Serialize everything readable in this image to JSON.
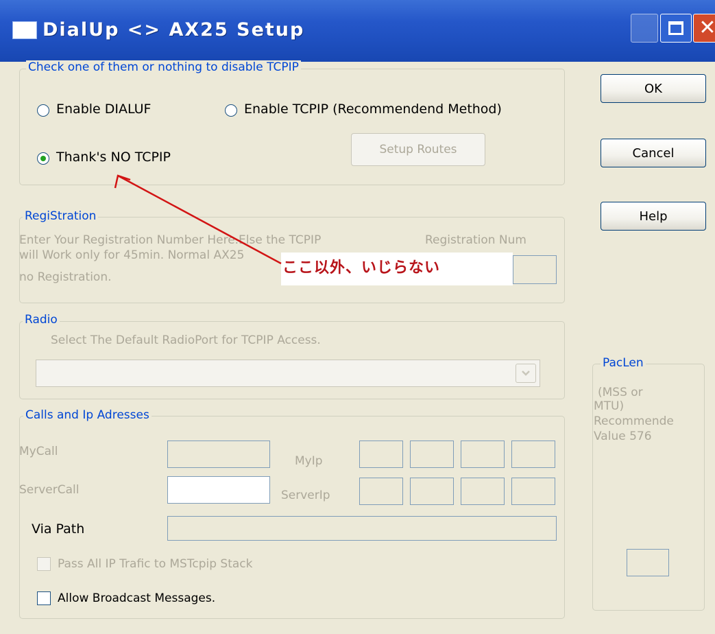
{
  "window": {
    "title": "DialUp <> AX25 Setup",
    "icons": {
      "min": "minimize-icon",
      "max": "maximize-icon",
      "close": "close-icon"
    },
    "close_glyph": "✕"
  },
  "tcpip_group": {
    "legend": "Check one of them or nothing to disable TCPIP",
    "options": [
      {
        "label": "Enable DIALUF",
        "selected": false
      },
      {
        "label": "Enable TCPIP (Recommendend Method)",
        "selected": false
      },
      {
        "label": "Thank's NO TCPIP",
        "selected": true
      }
    ],
    "setup_routes": "Setup Routes"
  },
  "buttons": {
    "ok": "OK",
    "cancel": "Cancel",
    "help": "Help"
  },
  "registration": {
    "legend": "RegiStration",
    "line1": "Enter Your Registration Number Here.Else the TCPIP",
    "line2": "will Work only for 45min. Normal AX25",
    "line3": "no Registration.",
    "num_label": "Registration Num"
  },
  "annotation": {
    "text": "ここ以外、いじらない",
    "color": "#d21414"
  },
  "radio": {
    "legend": "Radio",
    "caption": "Select The Default RadioPort for TCPIP Access.",
    "dropdown_value": ""
  },
  "pacLen": {
    "legend": "PacLen",
    "line1": "(MSS or",
    "line2": "MTU)",
    "line3": "Recommende",
    "line4": "Value 576"
  },
  "calls": {
    "legend": "Calls and Ip Adresses",
    "mycall": "MyCall",
    "myip": "MyIp",
    "servercall": "ServerCall",
    "serverip": "ServerIp",
    "via_path": "Via Path",
    "pass_all": "Pass All IP Trafic to MSTcpip Stack",
    "allow_broadcast": "Allow Broadcast Messages."
  },
  "colors": {
    "titlebar": "#2557c9",
    "dialog_bg": "#ece9d8",
    "group_legend_blue": "#0046d5",
    "disabled_text": "#aca899"
  }
}
